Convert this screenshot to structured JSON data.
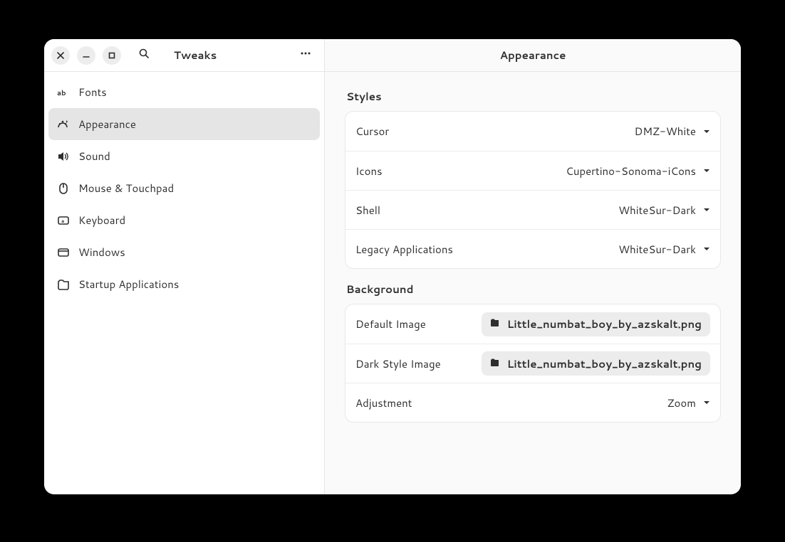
{
  "window": {
    "app_title": "Tweaks",
    "page_title": "Appearance"
  },
  "sidebar": {
    "items": [
      {
        "label": "Fonts",
        "icon": "fonts-icon",
        "active": false
      },
      {
        "label": "Appearance",
        "icon": "appearance-icon",
        "active": true
      },
      {
        "label": "Sound",
        "icon": "sound-icon",
        "active": false
      },
      {
        "label": "Mouse & Touchpad",
        "icon": "mouse-icon",
        "active": false
      },
      {
        "label": "Keyboard",
        "icon": "keyboard-icon",
        "active": false
      },
      {
        "label": "Windows",
        "icon": "windows-icon",
        "active": false
      },
      {
        "label": "Startup Applications",
        "icon": "startup-icon",
        "active": false
      }
    ]
  },
  "sections": {
    "styles": {
      "heading": "Styles",
      "rows": [
        {
          "label": "Cursor",
          "value": "DMZ-White"
        },
        {
          "label": "Icons",
          "value": "Cupertino-Sonoma-iCons"
        },
        {
          "label": "Shell",
          "value": "WhiteSur-Dark"
        },
        {
          "label": "Legacy Applications",
          "value": "WhiteSur-Dark"
        }
      ]
    },
    "background": {
      "heading": "Background",
      "rows": [
        {
          "label": "Default Image",
          "type": "file",
          "value": "Little_numbat_boy_by_azskalt.png"
        },
        {
          "label": "Dark Style Image",
          "type": "file",
          "value": "Little_numbat_boy_by_azskalt.png"
        },
        {
          "label": "Adjustment",
          "type": "combo",
          "value": "Zoom"
        }
      ]
    }
  }
}
